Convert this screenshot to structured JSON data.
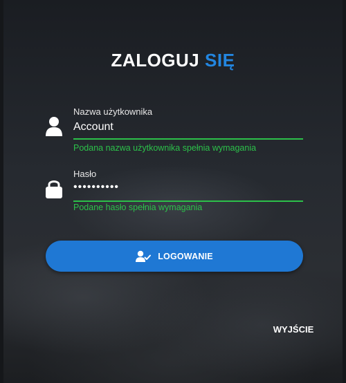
{
  "title": {
    "main": "ZALOGUJ",
    "accent": "SIĘ"
  },
  "colors": {
    "accent": "#2386e0",
    "success": "#2cc14a",
    "button": "#1f78d4"
  },
  "username": {
    "label": "Nazwa użytkownika",
    "value": "Account",
    "help": "Podana nazwa użytkownika spełnia wymagania",
    "icon": "user-icon"
  },
  "password": {
    "label": "Hasło",
    "value": "••••••••••",
    "help": "Podane hasło spełnia wymagania",
    "icon": "lock-icon"
  },
  "login_button": {
    "label": "LOGOWANIE",
    "icon": "user-check-icon"
  },
  "exit_button": {
    "label": "WYJŚCIE"
  }
}
